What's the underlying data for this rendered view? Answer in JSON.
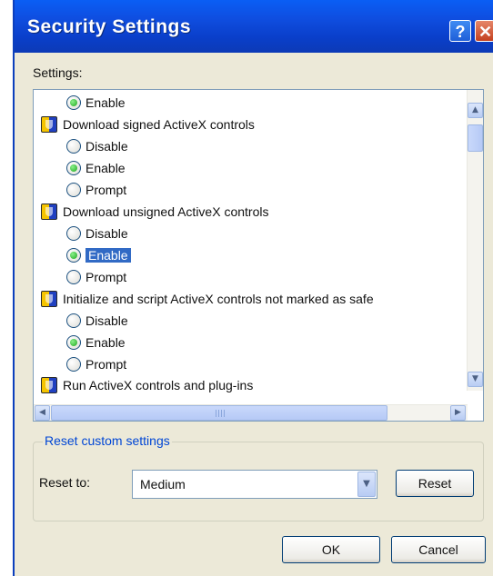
{
  "window": {
    "title": "Security Settings",
    "help_glyph": "?",
    "close_glyph": "✕"
  },
  "settings_label": "Settings:",
  "tree": {
    "rows": [
      {
        "kind": "radio",
        "label": "Enable",
        "checked": true
      },
      {
        "kind": "heading",
        "label": "Download signed ActiveX controls"
      },
      {
        "kind": "radio",
        "label": "Disable",
        "checked": false
      },
      {
        "kind": "radio",
        "label": "Enable",
        "checked": true
      },
      {
        "kind": "radio",
        "label": "Prompt",
        "checked": false
      },
      {
        "kind": "heading",
        "label": "Download unsigned ActiveX controls"
      },
      {
        "kind": "radio",
        "label": "Disable",
        "checked": false
      },
      {
        "kind": "radio",
        "label": "Enable",
        "checked": true,
        "selected": true
      },
      {
        "kind": "radio",
        "label": "Prompt",
        "checked": false
      },
      {
        "kind": "heading",
        "label": "Initialize and script ActiveX controls not marked as safe"
      },
      {
        "kind": "radio",
        "label": "Disable",
        "checked": false
      },
      {
        "kind": "radio",
        "label": "Enable",
        "checked": true
      },
      {
        "kind": "radio",
        "label": "Prompt",
        "checked": false
      },
      {
        "kind": "heading",
        "label": "Run ActiveX controls and plug-ins"
      }
    ]
  },
  "scroll": {
    "up": "▲",
    "down": "▼",
    "left": "◀",
    "right": "▶"
  },
  "reset_group": {
    "legend": "Reset custom settings",
    "reset_to_label": "Reset to:",
    "selected_level": "Medium",
    "reset_button": "Reset"
  },
  "buttons": {
    "ok": "OK",
    "cancel": "Cancel"
  },
  "colors": {
    "titlebar": "#0a3fcb",
    "selection": "#316ac5",
    "group_legend": "#0046d5",
    "dialog_bg": "#ece9d8"
  }
}
